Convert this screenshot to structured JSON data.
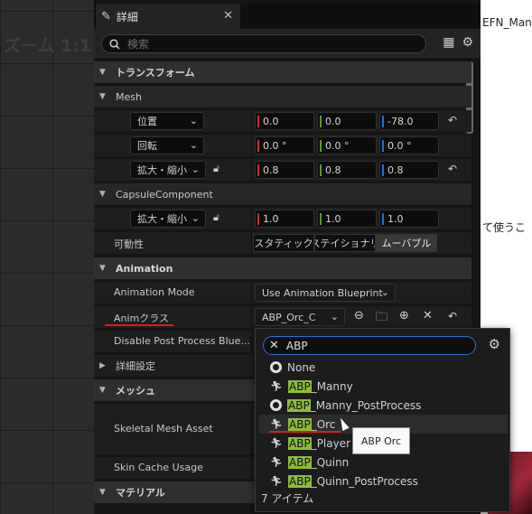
{
  "background": {
    "zoom_label": "ズーム 1:1",
    "right_text_1": "EFN_Man",
    "right_text_2": "て使うこ"
  },
  "panel": {
    "tab_title": "詳細",
    "search_placeholder": "検索",
    "sections": {
      "transform": "トランスフォーム",
      "mesh": "Mesh",
      "capsule": "CapsuleComponent",
      "animation": "Animation",
      "advanced": "詳細設定",
      "mesh_jp": "メッシュ",
      "material": "マテリアル"
    },
    "mesh": {
      "location": {
        "label": "位置",
        "x": "0.0",
        "y": "0.0",
        "z": "-78.0"
      },
      "rotation": {
        "label": "回転",
        "x": "0.0 °",
        "y": "0.0 °",
        "z": "0.0 °"
      },
      "scale": {
        "label": "拡大・縮小",
        "x": "0.8",
        "y": "0.8",
        "z": "0.8"
      }
    },
    "capsule": {
      "scale": {
        "label": "拡大・縮小",
        "x": "1.0",
        "y": "1.0",
        "z": "1.0"
      },
      "mobility": {
        "label": "可動性",
        "options": [
          "スタティック",
          "ステイショナリ",
          "ムーバブル"
        ],
        "selected": "ムーバブル"
      }
    },
    "animation": {
      "mode_label": "Animation Mode",
      "mode_value": "Use Animation Blueprint",
      "anim_class_label": "Animクラス",
      "anim_class_value": "ABP_Orc_C",
      "disable_pp_label": "Disable Post Process Blue..."
    },
    "mesh_jp": {
      "skeletal_label": "Skeletal Mesh Asset",
      "skin_cache_label": "Skin Cache Usage"
    }
  },
  "popup": {
    "search_value": "ABP",
    "items": [
      {
        "prefix": "",
        "rest": "None",
        "icon": "radio-icon"
      },
      {
        "prefix": "ABP",
        "rest": "_Manny",
        "icon": "anim-blueprint-icon"
      },
      {
        "prefix": "ABP",
        "rest": "_Manny_PostProcess",
        "icon": "radio-icon"
      },
      {
        "prefix": "ABP",
        "rest": "_Orc",
        "icon": "anim-blueprint-icon"
      },
      {
        "prefix": "ABP",
        "rest": "_Player",
        "icon": "anim-blueprint-icon"
      },
      {
        "prefix": "ABP",
        "rest": "_Quinn",
        "icon": "anim-blueprint-icon"
      },
      {
        "prefix": "ABP",
        "rest": "_Quinn_PostProcess",
        "icon": "anim-blueprint-icon"
      }
    ],
    "footer": "7 アイテム",
    "tooltip": "ABP Orc"
  },
  "colors": {
    "annotation_red": "#d81e1e",
    "highlight_green": "#8cbc3c",
    "accent_blue": "#2e6fd6"
  }
}
